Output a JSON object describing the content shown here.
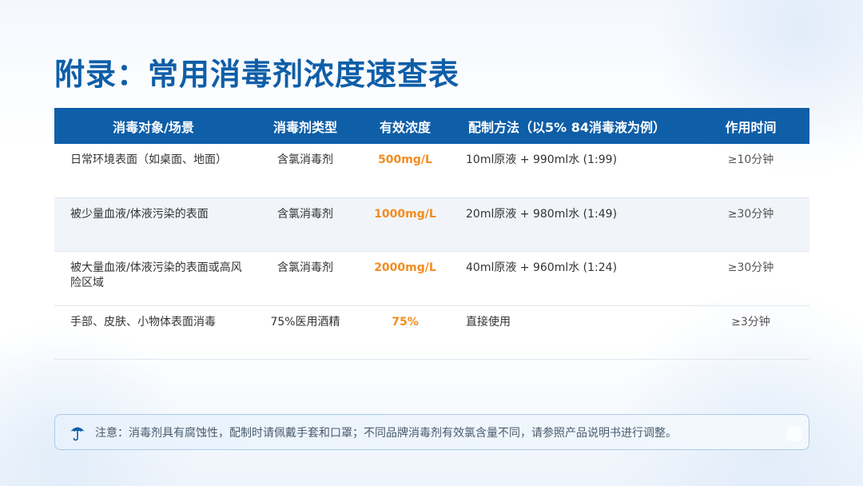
{
  "title": "附录：常用消毒剂浓度速查表",
  "table": {
    "headers": [
      "消毒对象/场景",
      "消毒剂类型",
      "有效浓度",
      "配制方法（以5% 84消毒液为例）",
      "作用时间"
    ],
    "rows": [
      {
        "target": "日常环境表面（如桌面、地面）",
        "type": "含氯消毒剂",
        "concentration": "500mg/L",
        "method": "10ml原液 + 990ml水 (1:99)",
        "time": "≥10分钟"
      },
      {
        "target": "被少量血液/体液污染的表面",
        "type": "含氯消毒剂",
        "concentration": "1000mg/L",
        "method": "20ml原液 + 980ml水 (1:49)",
        "time": "≥30分钟"
      },
      {
        "target": "被大量血液/体液污染的表面或高风险区域",
        "type": "含氯消毒剂",
        "concentration": "2000mg/L",
        "method": "40ml原液 + 960ml水 (1:24)",
        "time": "≥30分钟"
      },
      {
        "target": "手部、皮肤、小物体表面消毒",
        "type": "75%医用酒精",
        "concentration": "75%",
        "method": "直接使用",
        "time": "≥3分钟"
      }
    ]
  },
  "note": {
    "icon": "umbrella-icon",
    "text": "注意：消毒剂具有腐蚀性，配制时请佩戴手套和口罩；不同品牌消毒剂有效氯含量不同，请参照产品说明书进行调整。"
  },
  "colors": {
    "primary": "#0e5ea8",
    "accent": "#f28c1f",
    "row_alt": "#f1f5fa"
  }
}
